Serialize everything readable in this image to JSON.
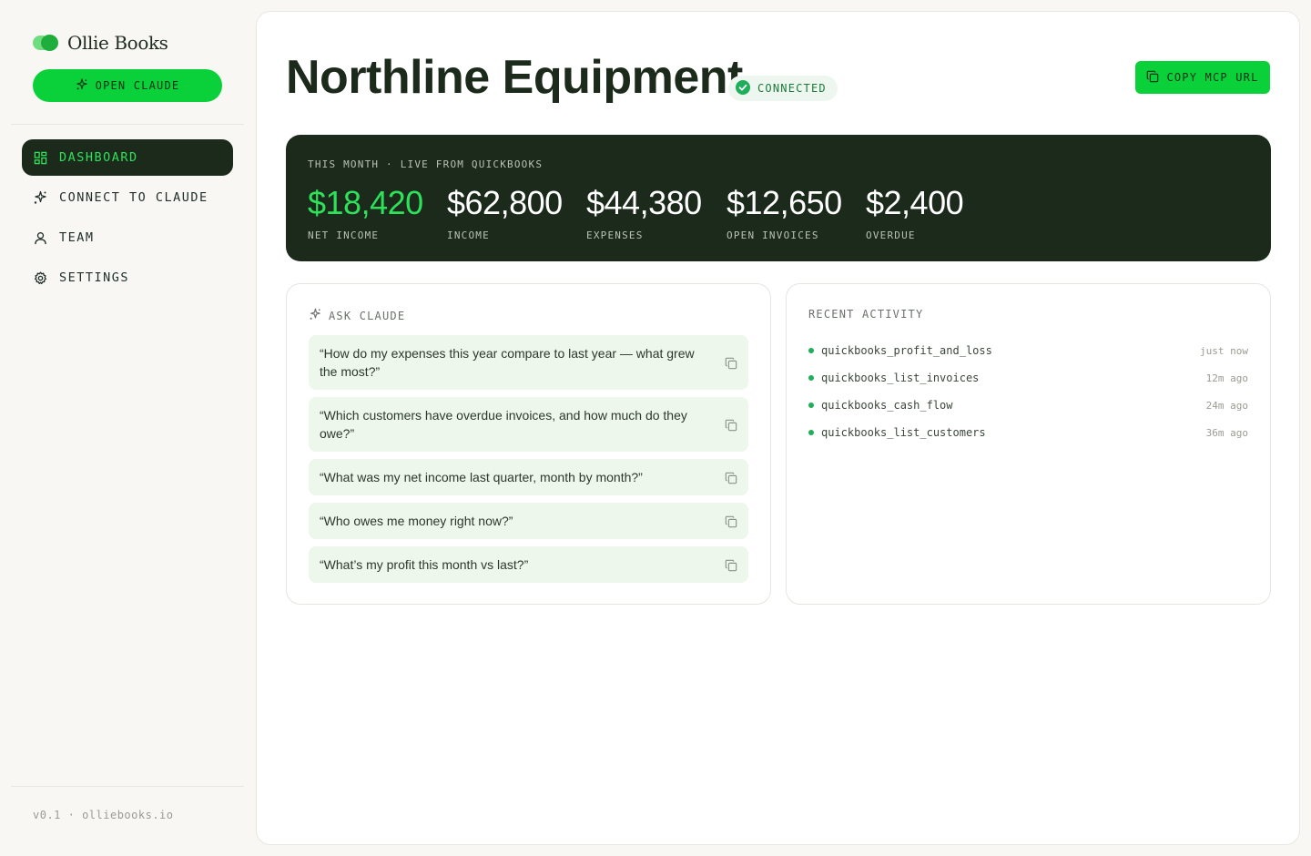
{
  "brand": {
    "name": "Ollie Books"
  },
  "sidebar": {
    "open_claude_label": "OPEN CLAUDE",
    "items": [
      {
        "label": "DASHBOARD",
        "icon": "dashboard-icon",
        "active": true
      },
      {
        "label": "CONNECT TO CLAUDE",
        "icon": "sparkle-icon",
        "active": false
      },
      {
        "label": "TEAM",
        "icon": "user-icon",
        "active": false
      },
      {
        "label": "SETTINGS",
        "icon": "gear-icon",
        "active": false
      }
    ],
    "footer": "v0.1 · olliebooks.io"
  },
  "header": {
    "title": "Northline Equipment",
    "status": "CONNECTED",
    "copy_button_label": "COPY MCP URL"
  },
  "stats": {
    "label": "THIS MONTH · LIVE FROM QUICKBOOKS",
    "items": [
      {
        "value": "$18,420",
        "label": "NET INCOME"
      },
      {
        "value": "$62,800",
        "label": "INCOME"
      },
      {
        "value": "$44,380",
        "label": "EXPENSES"
      },
      {
        "value": "$12,650",
        "label": "OPEN INVOICES"
      },
      {
        "value": "$2,400",
        "label": "OVERDUE"
      }
    ]
  },
  "ask": {
    "title": "ASK CLAUDE",
    "prompts": [
      "“How do my expenses this year compare to last year — what grew the most?”",
      "“Which customers have overdue invoices, and how much do they owe?”",
      "“What was my net income last quarter, month by month?”",
      "“Who owes me money right now?”",
      "“What’s my profit this month vs last?”"
    ]
  },
  "activity": {
    "title": "RECENT ACTIVITY",
    "items": [
      {
        "name": "quickbooks_profit_and_loss",
        "time": "just now"
      },
      {
        "name": "quickbooks_list_invoices",
        "time": "12m ago"
      },
      {
        "name": "quickbooks_cash_flow",
        "time": "24m ago"
      },
      {
        "name": "quickbooks_list_customers",
        "time": "36m ago"
      }
    ]
  },
  "colors": {
    "accent": "#0ad13a",
    "dark": "#1c2a1c",
    "positive": "#2ee05a"
  }
}
